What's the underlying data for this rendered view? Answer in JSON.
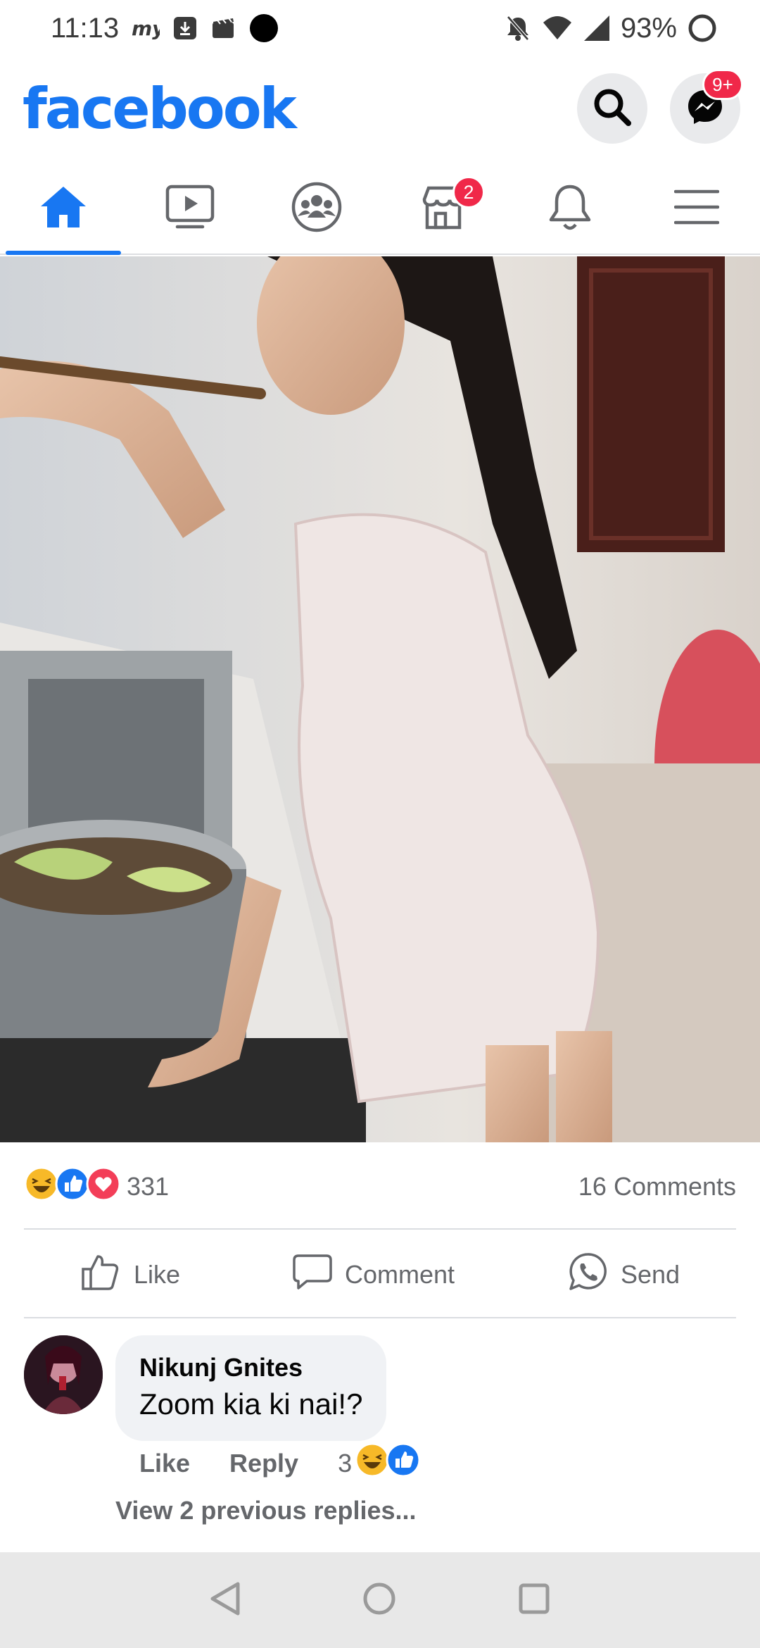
{
  "status_bar": {
    "time": "11:13",
    "battery": "93%",
    "left_icons": [
      "my-app-icon",
      "download-icon",
      "clapper-icon",
      "dot-icon"
    ],
    "right_icons": [
      "mute-bell-icon",
      "wifi-icon",
      "signal-icon",
      "battery-ring-icon"
    ]
  },
  "header": {
    "logo": "facebook",
    "messenger_badge": "9+",
    "brand_color": "#1877f2"
  },
  "nav": {
    "tabs": [
      {
        "name": "home",
        "active": true
      },
      {
        "name": "watch",
        "active": false
      },
      {
        "name": "groups",
        "active": false
      },
      {
        "name": "marketplace",
        "active": false,
        "badge": "2"
      },
      {
        "name": "notifications",
        "active": false
      },
      {
        "name": "menu",
        "active": false
      }
    ]
  },
  "post": {
    "reaction_count": "331",
    "reaction_types": [
      "haha",
      "like",
      "love"
    ],
    "comments_count": "16 Comments",
    "actions": {
      "like": "Like",
      "comment": "Comment",
      "send": "Send"
    }
  },
  "comment": {
    "author": "Nikunj Gnites",
    "text": "Zoom kia ki nai!?",
    "like_label": "Like",
    "reply_label": "Reply",
    "reaction_count": "3",
    "view_replies": "View 2 previous replies..."
  }
}
